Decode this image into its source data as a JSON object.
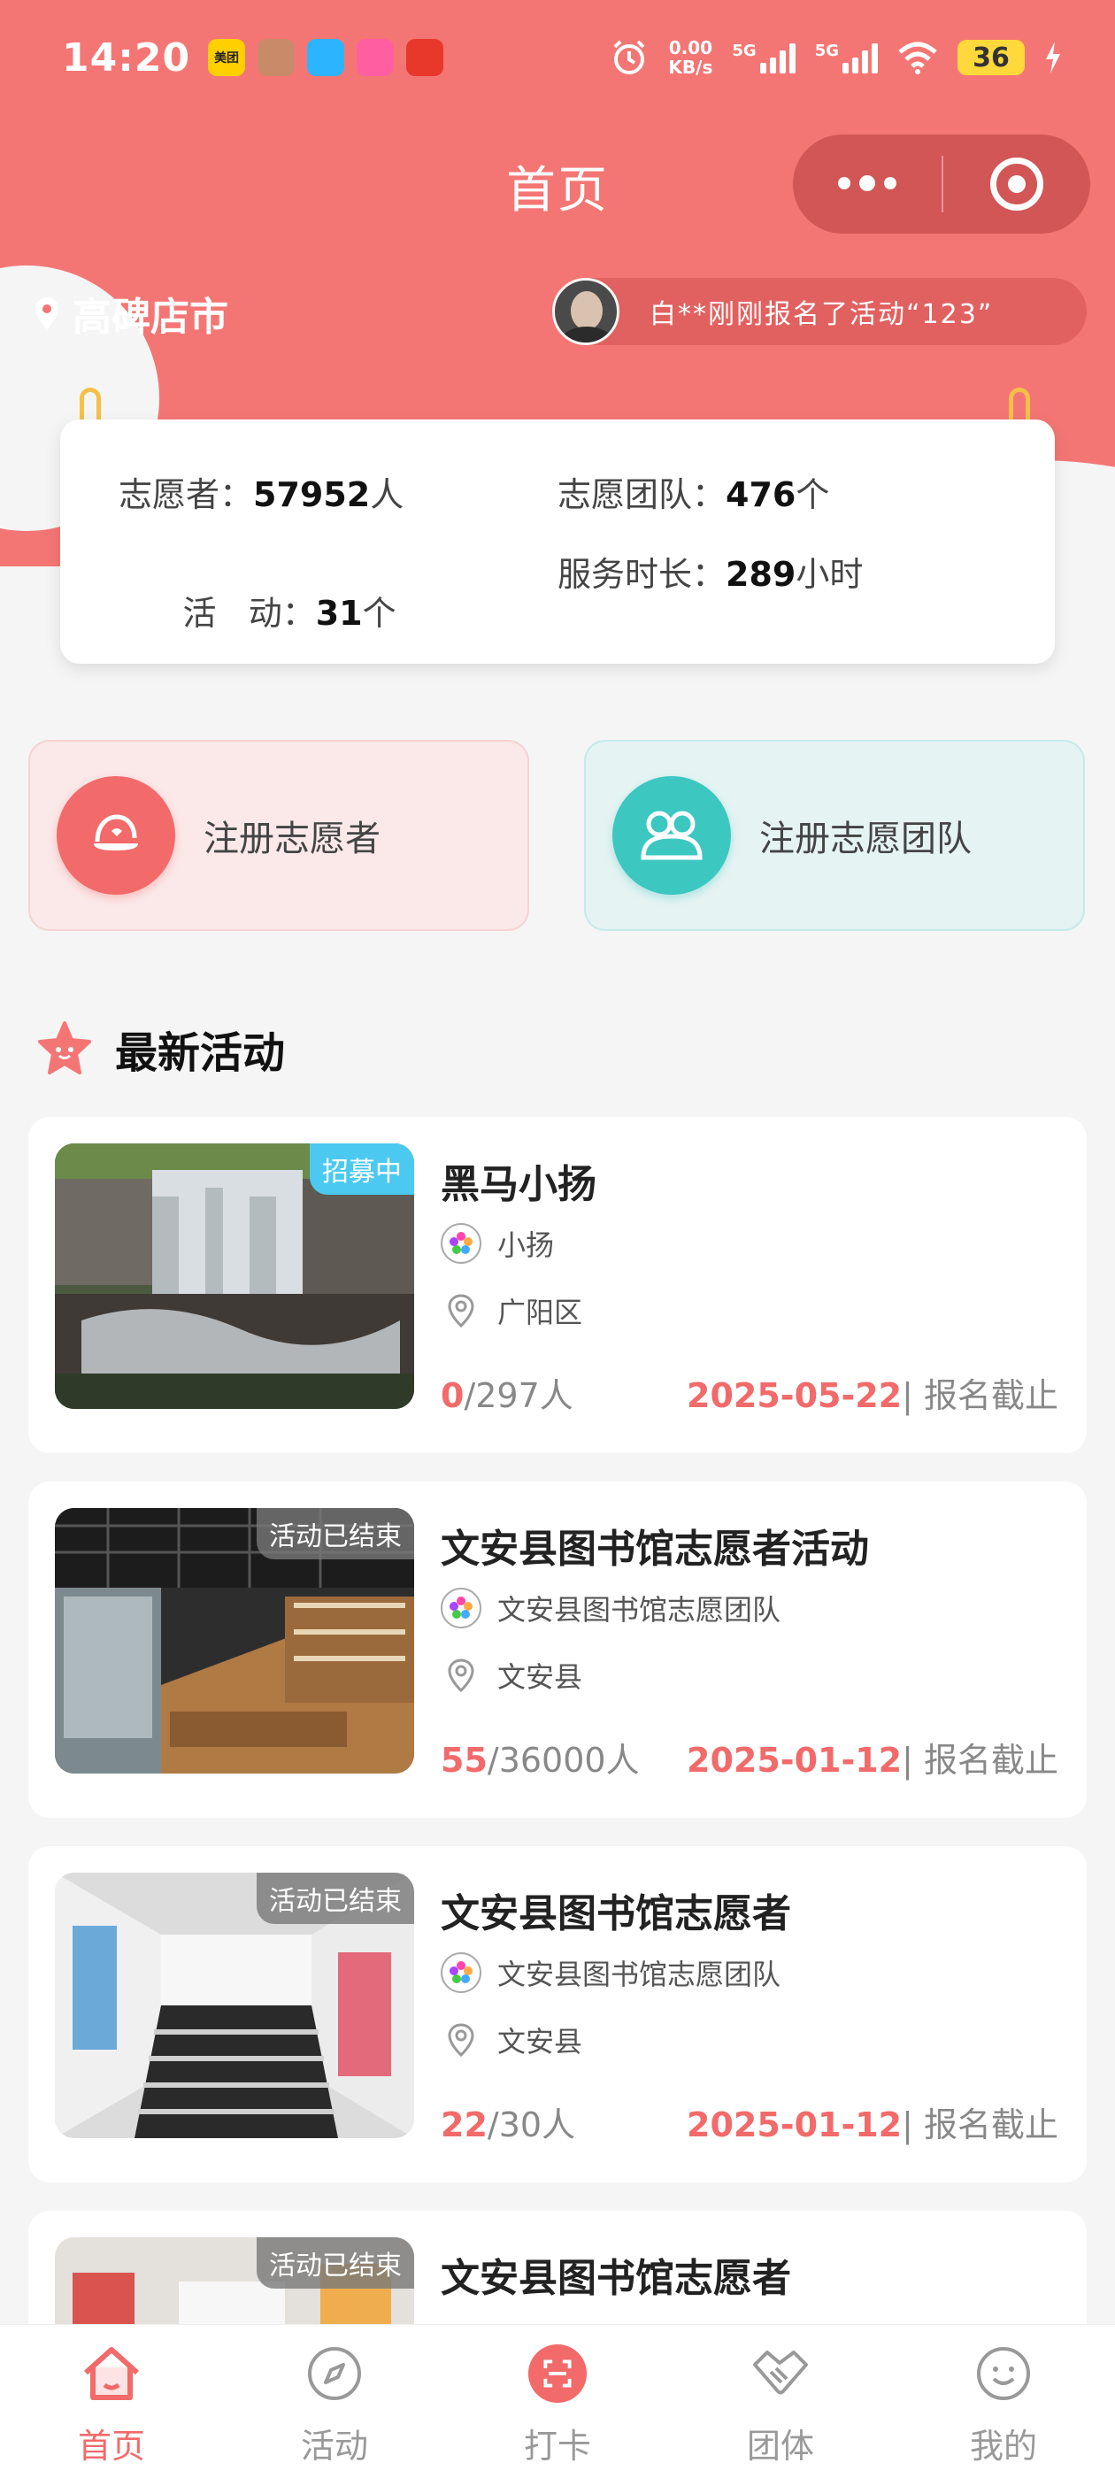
{
  "status_bar": {
    "time": "14:20",
    "apps": [
      "美团",
      "",
      "",
      "",
      ""
    ],
    "net_speed_value": "0.00",
    "net_speed_unit": "KB/s",
    "sim1": "5G",
    "sim2": "5G",
    "battery": "36"
  },
  "nav": {
    "title": "首页"
  },
  "location": {
    "city": "高碑店市"
  },
  "ticker": {
    "message": "白**刚刚报名了活动“123”"
  },
  "stats": {
    "volunteers_label": "志愿者：",
    "volunteers_value": "57952",
    "volunteers_unit": "人",
    "teams_label": "志愿团队：",
    "teams_value": "476",
    "teams_unit": "个",
    "activities_label": "活   动：",
    "activities_value": "31",
    "activities_unit": "个",
    "hours_label": "服务时长：",
    "hours_value": "289",
    "hours_unit": "小时"
  },
  "register": {
    "volunteer_label": "注册志愿者",
    "team_label": "注册志愿团队"
  },
  "section": {
    "title": "最新活动"
  },
  "activities": [
    {
      "status": "招募中",
      "title": "黑马小扬",
      "org": "小扬",
      "location": "广阳区",
      "signed": "0",
      "total": "/297人",
      "deadline": "2025-05-22",
      "deadline_suffix": "| 报名截止"
    },
    {
      "status": "活动已结束",
      "title": "文安县图书馆志愿者活动",
      "org": "文安县图书馆志愿团队",
      "location": "文安县",
      "signed": "55",
      "total": "/36000人",
      "deadline": "2025-01-12",
      "deadline_suffix": "| 报名截止"
    },
    {
      "status": "活动已结束",
      "title": "文安县图书馆志愿者",
      "org": "文安县图书馆志愿团队",
      "location": "文安县",
      "signed": "22",
      "total": "/30人",
      "deadline": "2025-01-12",
      "deadline_suffix": "| 报名截止"
    },
    {
      "status": "活动已结束",
      "title": "文安县图书馆志愿者"
    }
  ],
  "tabbar": {
    "home": "首页",
    "activity": "活动",
    "checkin": "打卡",
    "group": "团体",
    "mine": "我的"
  },
  "colors": {
    "brand": "#f47674",
    "accent": "#f26a6a",
    "teal": "#3cc7c1",
    "open_badge": "#4cc9f0"
  }
}
